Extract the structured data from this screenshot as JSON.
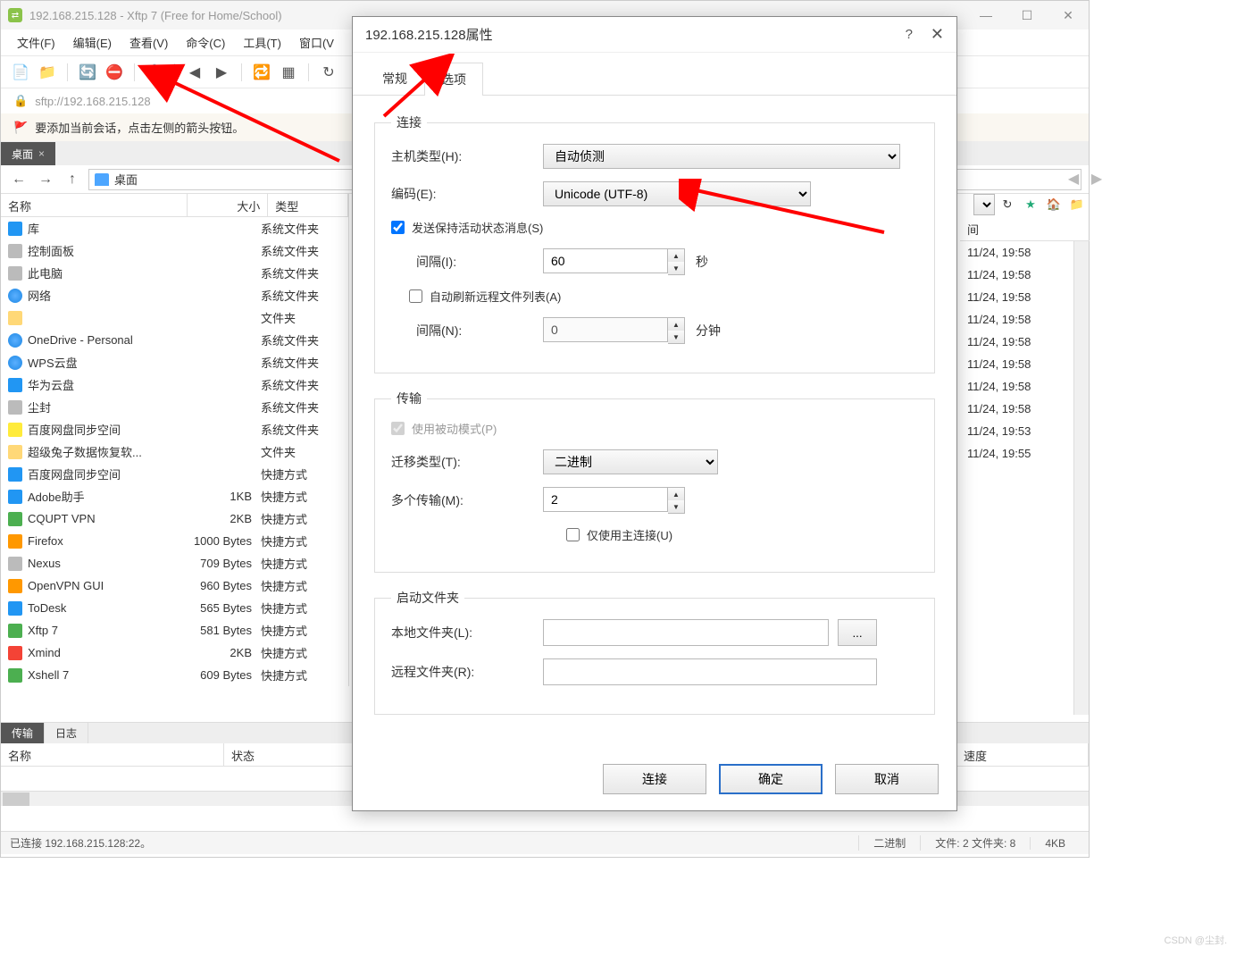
{
  "window": {
    "title": "192.168.215.128 - Xftp 7 (Free for Home/School)"
  },
  "menubar": {
    "items": [
      "文件(F)",
      "编辑(E)",
      "查看(V)",
      "命令(C)",
      "工具(T)",
      "窗口(V"
    ]
  },
  "address": {
    "url": "sftp://192.168.215.128",
    "hint": "要添加当前会话，点击左侧的箭头按钮。"
  },
  "session_tab": {
    "label": "桌面"
  },
  "path_combo": {
    "label": "桌面"
  },
  "left_header": {
    "name": "名称",
    "size": "大小",
    "type": "类型"
  },
  "files": [
    {
      "name": "库",
      "size": "",
      "type": "系统文件夹",
      "ico": "ico blue"
    },
    {
      "name": "控制面板",
      "size": "",
      "type": "系统文件夹",
      "ico": "ico gray"
    },
    {
      "name": "此电脑",
      "size": "",
      "type": "系统文件夹",
      "ico": "ico gray"
    },
    {
      "name": "网络",
      "size": "",
      "type": "系统文件夹",
      "ico": "ico cloud-blue"
    },
    {
      "name": "",
      "size": "",
      "type": "文件夹",
      "ico": "ico folder"
    },
    {
      "name": "OneDrive - Personal",
      "size": "",
      "type": "系统文件夹",
      "ico": "ico cloud-blue"
    },
    {
      "name": "WPS云盘",
      "size": "",
      "type": "系统文件夹",
      "ico": "ico cloud-blue"
    },
    {
      "name": "华为云盘",
      "size": "",
      "type": "系统文件夹",
      "ico": "ico blue"
    },
    {
      "name": "尘封",
      "size": "",
      "type": "系统文件夹",
      "ico": "ico gray"
    },
    {
      "name": "百度网盘同步空间",
      "size": "",
      "type": "系统文件夹",
      "ico": "ico yellow"
    },
    {
      "name": "超级兔子数据恢复软...",
      "size": "",
      "type": "文件夹",
      "ico": "ico folder"
    },
    {
      "name": "百度网盘同步空间",
      "size": "",
      "type": "快捷方式",
      "ico": "ico blue"
    },
    {
      "name": "Adobe助手",
      "size": "1KB",
      "type": "快捷方式",
      "ico": "ico blue"
    },
    {
      "name": "CQUPT VPN",
      "size": "2KB",
      "type": "快捷方式",
      "ico": "ico green"
    },
    {
      "name": "Firefox",
      "size": "1000 Bytes",
      "type": "快捷方式",
      "ico": "ico orange"
    },
    {
      "name": "Nexus",
      "size": "709 Bytes",
      "type": "快捷方式",
      "ico": "ico gray"
    },
    {
      "name": "OpenVPN GUI",
      "size": "960 Bytes",
      "type": "快捷方式",
      "ico": "ico orange"
    },
    {
      "name": "ToDesk",
      "size": "565 Bytes",
      "type": "快捷方式",
      "ico": "ico blue"
    },
    {
      "name": "Xftp 7",
      "size": "581 Bytes",
      "type": "快捷方式",
      "ico": "ico green"
    },
    {
      "name": "Xmind",
      "size": "2KB",
      "type": "快捷方式",
      "ico": "ico red"
    },
    {
      "name": "Xshell 7",
      "size": "609 Bytes",
      "type": "快捷方式",
      "ico": "ico green"
    }
  ],
  "right_header": {
    "modified": "间"
  },
  "right_times": [
    "11/24, 19:58",
    "11/24, 19:58",
    "11/24, 19:58",
    "11/24, 19:58",
    "11/24, 19:58",
    "11/24, 19:58",
    "11/24, 19:58",
    "11/24, 19:58",
    "11/24, 19:53",
    "11/24, 19:55"
  ],
  "bottom_tabs": {
    "transfer": "传输",
    "log": "日志",
    "name_col": "名称",
    "status_col": "状态",
    "speed_col": "速度"
  },
  "status": {
    "conn": "已连接 192.168.215.128:22。",
    "mode": "二进制",
    "files": "文件: 2 文件夹: 8",
    "size": "4KB"
  },
  "dialog": {
    "title": "192.168.215.128属性",
    "tabs": {
      "general": "常规",
      "options": "选项"
    },
    "conn_group": "连接",
    "host_type_label": "主机类型(H):",
    "host_type_value": "自动侦测",
    "encoding_label": "编码(E):",
    "encoding_value": "Unicode (UTF-8)",
    "keepalive_label": "发送保持活动状态消息(S)",
    "interval_I_label": "间隔(I):",
    "interval_I_value": "60",
    "seconds_unit": "秒",
    "auto_refresh_label": "自动刷新远程文件列表(A)",
    "interval_N_label": "间隔(N):",
    "interval_N_value": "0",
    "minutes_unit": "分钟",
    "transfer_group": "传输",
    "passive_label": "使用被动模式(P)",
    "migration_type_label": "迁移类型(T):",
    "migration_type_value": "二进制",
    "multi_transfer_label": "多个传输(M):",
    "multi_transfer_value": "2",
    "main_conn_label": "仅使用主连接(U)",
    "startup_group": "启动文件夹",
    "local_folder_label": "本地文件夹(L):",
    "remote_folder_label": "远程文件夹(R):",
    "browse": "...",
    "connect_btn": "连接",
    "ok_btn": "确定",
    "cancel_btn": "取消"
  },
  "watermark": "CSDN @尘封."
}
